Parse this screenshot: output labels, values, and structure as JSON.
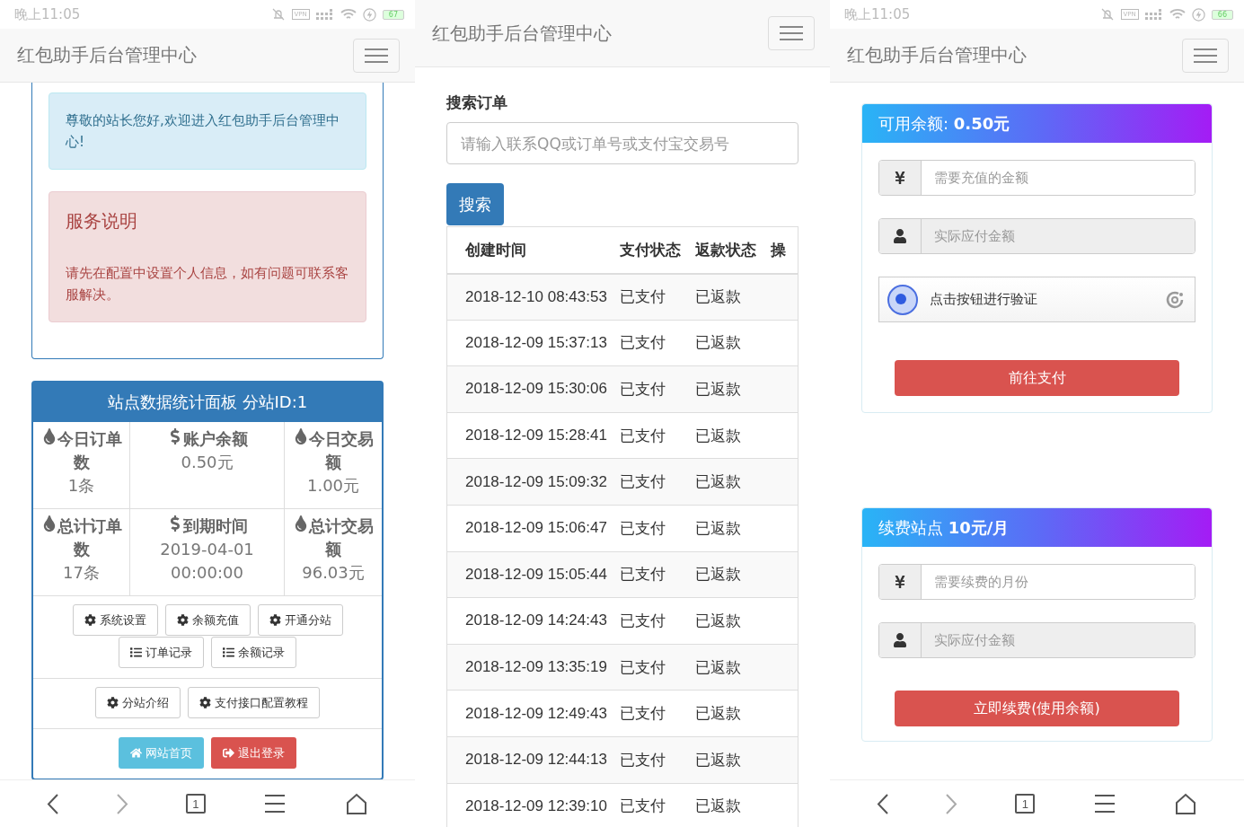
{
  "left_screen": {
    "status_bar": {
      "time": "晚上11:05",
      "vpn_label": "VPN",
      "battery": "67"
    },
    "navbar": {
      "title": "红包助手后台管理中心"
    },
    "welcome_alert": "尊敬的站长您好,欢迎进入红包助手后台管理中心!",
    "service_notice": {
      "title": "服务说明",
      "text": "请先在配置中设置个人信息，如有问题可联系客服解决。"
    },
    "stats_panel": {
      "title": "站点数据统计面板 分站ID:1",
      "stats": [
        {
          "kind": "drop",
          "label": "今日订单数",
          "value": "1条"
        },
        {
          "kind": "dollar",
          "label": "账户余额",
          "value": "0.50元"
        },
        {
          "kind": "drop",
          "label": "今日交易额",
          "value": "1.00元"
        },
        {
          "kind": "drop",
          "label": "总计订单数",
          "value": "17条"
        },
        {
          "kind": "dollar",
          "label": "到期时间",
          "value": "2019-04-01 00:00:00"
        },
        {
          "kind": "drop",
          "label": "总计交易额",
          "value": "96.03元"
        }
      ],
      "button_groups": [
        [
          {
            "kind": "settings",
            "label": "系统设置"
          },
          {
            "kind": "settings",
            "label": "余额充值"
          },
          {
            "kind": "settings",
            "label": "开通分站"
          },
          {
            "kind": "records",
            "label": "订单记录"
          },
          {
            "kind": "records",
            "label": "余额记录"
          }
        ],
        [
          {
            "kind": "settings",
            "label": "分站介绍"
          },
          {
            "kind": "settings",
            "label": "支付接口配置教程"
          }
        ],
        [
          {
            "kind": "home",
            "label": "网站首页"
          },
          {
            "kind": "logout",
            "label": "退出登录"
          }
        ]
      ]
    },
    "bottom_nav": [
      {
        "kind": "back",
        "disabled": false
      },
      {
        "kind": "forward",
        "disabled": true
      },
      {
        "kind": "tabs",
        "label": "1",
        "disabled": false
      },
      {
        "kind": "menu",
        "disabled": false
      },
      {
        "kind": "home",
        "disabled": false
      }
    ]
  },
  "middle_screen": {
    "navbar": {
      "title": "红包助手后台管理中心"
    },
    "search": {
      "label": "搜索订单",
      "placeholder": "请输入联系QQ或订单号或支付宝交易号",
      "button": "搜索"
    },
    "table": {
      "columns": [
        "创建时间",
        "支付状态",
        "返款状态",
        "操"
      ],
      "rows": [
        [
          "2018-12-10 08:43:53",
          "已支付",
          "已返款"
        ],
        [
          "2018-12-09 15:37:13",
          "已支付",
          "已返款"
        ],
        [
          "2018-12-09 15:30:06",
          "已支付",
          "已返款"
        ],
        [
          "2018-12-09 15:28:41",
          "已支付",
          "已返款"
        ],
        [
          "2018-12-09 15:09:32",
          "已支付",
          "已返款"
        ],
        [
          "2018-12-09 15:06:47",
          "已支付",
          "已返款"
        ],
        [
          "2018-12-09 15:05:44",
          "已支付",
          "已返款"
        ],
        [
          "2018-12-09 14:24:43",
          "已支付",
          "已返款"
        ],
        [
          "2018-12-09 13:35:19",
          "已支付",
          "已返款"
        ],
        [
          "2018-12-09 12:49:43",
          "已支付",
          "已返款"
        ],
        [
          "2018-12-09 12:44:13",
          "已支付",
          "已返款"
        ],
        [
          "2018-12-09 12:39:10",
          "已支付",
          "已返款"
        ]
      ]
    }
  },
  "right_screen": {
    "status_bar": {
      "time": "晚上11:05",
      "vpn_label": "VPN",
      "battery": "66"
    },
    "navbar": {
      "title": "红包助手后台管理中心"
    },
    "cards": [
      {
        "title": "可用余额: **0.50元**",
        "fields": [
          {
            "kind": "amount",
            "placeholder": "需要充值的金额",
            "disabled": false
          },
          {
            "kind": "payment",
            "placeholder": "实际应付金额",
            "disabled": true
          }
        ],
        "captcha": {
          "text": "点击按钮进行验证"
        },
        "button": "前往支付"
      },
      {
        "title": "续费站点 **10元/月**",
        "fields": [
          {
            "kind": "amount",
            "placeholder": "需要续费的月份",
            "disabled": false
          },
          {
            "kind": "payment",
            "placeholder": "实际应付金额",
            "disabled": true
          }
        ],
        "button": "立即续费(使用余额)"
      }
    ],
    "bottom_nav": [
      {
        "kind": "back",
        "disabled": false
      },
      {
        "kind": "forward",
        "disabled": true
      },
      {
        "kind": "tabs",
        "label": "1",
        "disabled": false
      },
      {
        "kind": "menu",
        "disabled": false
      },
      {
        "kind": "home",
        "disabled": false
      }
    ]
  }
}
